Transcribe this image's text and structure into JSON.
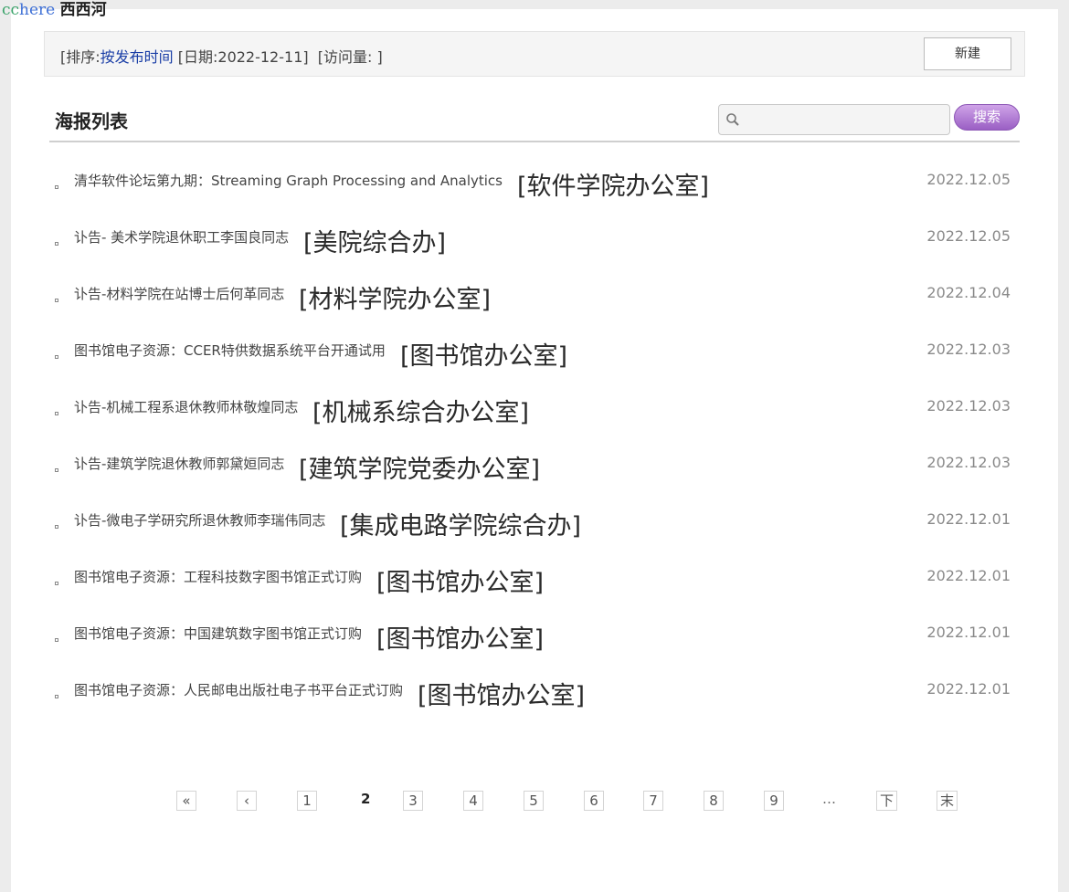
{
  "watermark": {
    "part1": "cc",
    "part2": "here",
    "part3": "西西河"
  },
  "topbar": {
    "sort_prefix": "[排序:",
    "sort_value": "按发布时间",
    "date_text": "[日期:2022-12-11]",
    "visits_text": "[访问量: ]",
    "new_button": "新建"
  },
  "section": {
    "title": "海报列表"
  },
  "search": {
    "placeholder": "",
    "button": "搜索"
  },
  "posters": [
    {
      "title": "清华软件论坛第九期：Streaming Graph Processing and Analytics",
      "dept": "[软件学院办公室]",
      "date": "2022.12.05"
    },
    {
      "title": "讣告- 美术学院退休职工李国良同志",
      "dept": "[美院综合办]",
      "date": "2022.12.05"
    },
    {
      "title": "讣告-材料学院在站博士后何革同志",
      "dept": "[材料学院办公室]",
      "date": "2022.12.04"
    },
    {
      "title": "图书馆电子资源：CCER特供数据系统平台开通试用",
      "dept": "[图书馆办公室]",
      "date": "2022.12.03"
    },
    {
      "title": "讣告-机械工程系退休教师林敬煌同志",
      "dept": "[机械系综合办公室]",
      "date": "2022.12.03"
    },
    {
      "title": "讣告-建筑学院退休教师郭黛姮同志",
      "dept": "[建筑学院党委办公室]",
      "date": "2022.12.03"
    },
    {
      "title": "讣告-微电子学研究所退休教师李瑞伟同志",
      "dept": "[集成电路学院综合办]",
      "date": "2022.12.01"
    },
    {
      "title": "图书馆电子资源：工程科技数字图书馆正式订购",
      "dept": "[图书馆办公室]",
      "date": "2022.12.01"
    },
    {
      "title": "图书馆电子资源：中国建筑数字图书馆正式订购",
      "dept": "[图书馆办公室]",
      "date": "2022.12.01"
    },
    {
      "title": "图书馆电子资源：人民邮电出版社电子书平台正式订购",
      "dept": "[图书馆办公室]",
      "date": "2022.12.01"
    }
  ],
  "pagination": {
    "first": "«",
    "prev": "‹",
    "pages": [
      "1",
      "2",
      "3",
      "4",
      "5",
      "6",
      "7",
      "8",
      "9"
    ],
    "current": "2",
    "ellipsis": "…",
    "next": "下",
    "last": "末"
  }
}
